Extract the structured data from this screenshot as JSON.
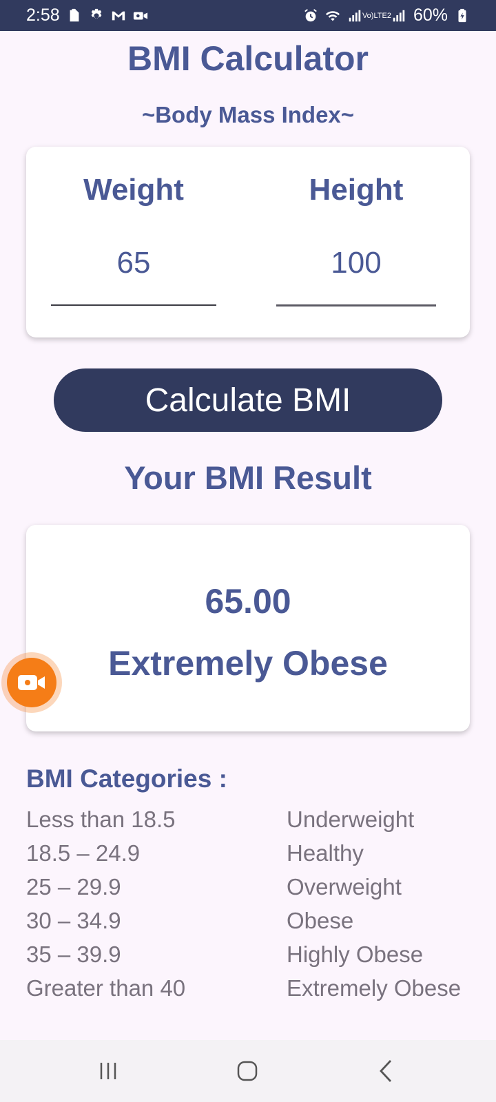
{
  "status_bar": {
    "time": "2:58",
    "left_icons": [
      "clipboard-icon",
      "settings-icon",
      "gmail-icon",
      "video-record-icon"
    ],
    "right_icons": [
      "alarm-icon",
      "wifi-icon",
      "signal-icon",
      "volte-icon",
      "signal-icon",
      "battery-icon"
    ],
    "volte_line1": "Vo)",
    "volte_line2": "LTE2",
    "battery": "60%"
  },
  "header": {
    "title": "BMI Calculator",
    "subtitle": "~Body Mass Index~"
  },
  "inputs": {
    "weight_label": "Weight",
    "weight_value": "65",
    "height_label": "Height",
    "height_value": "100"
  },
  "calculate_button": "Calculate BMI",
  "result": {
    "heading": "Your BMI Result",
    "value": "65.00",
    "category": "Extremely Obese"
  },
  "categories": {
    "heading": "BMI Categories :",
    "rows": [
      {
        "range": "Less than 18.5",
        "label": "Underweight"
      },
      {
        "range": "18.5 – 24.9",
        "label": "Healthy"
      },
      {
        "range": "25 – 29.9",
        "label": "Overweight"
      },
      {
        "range": "30 – 34.9",
        "label": "Obese"
      },
      {
        "range": "35 – 39.9",
        "label": "Highly Obese"
      },
      {
        "range": "Greater than 40",
        "label": "Extremely Obese"
      }
    ]
  },
  "nav_bar": {
    "buttons": [
      "recent-apps-icon",
      "home-icon",
      "back-icon"
    ]
  },
  "colors": {
    "primary": "#313a5e",
    "accent_text": "#4a5995",
    "background": "#fcf5fd",
    "muted_text": "#79727e",
    "record_button": "#f57d17"
  }
}
